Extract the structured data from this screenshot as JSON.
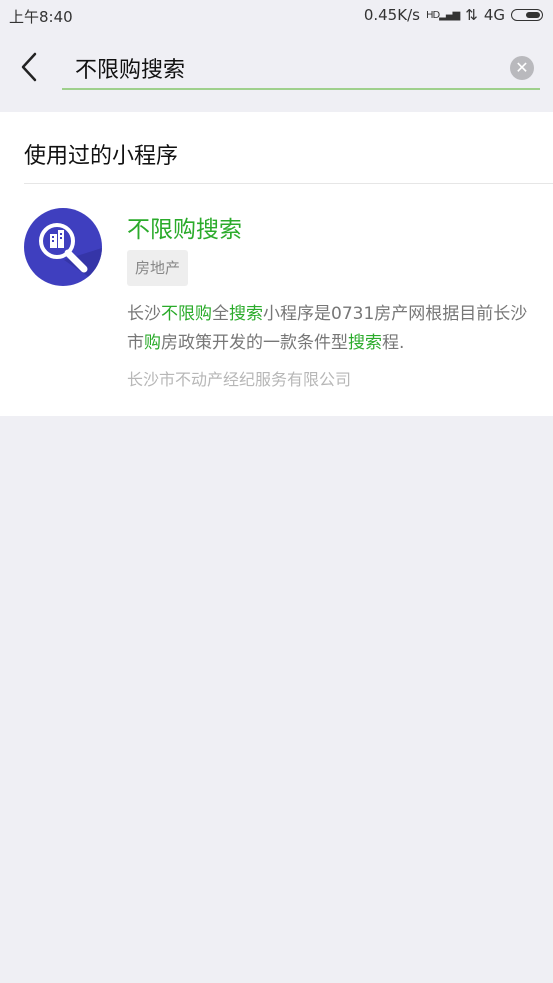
{
  "status": {
    "time": "上午8:40",
    "speed": "0.45K/s",
    "network": "4G",
    "signal_label": "HD"
  },
  "search": {
    "query": "不限购搜索"
  },
  "section": {
    "title": "使用过的小程序"
  },
  "result": {
    "name": "不限购搜索",
    "category": "房地产",
    "desc_segments": [
      "长沙",
      "不限购",
      "全",
      "搜索",
      "小程序是0731房产网根据目前长沙市",
      "购",
      "房政策开发的一款条件型",
      "搜索",
      "程."
    ],
    "company": "长沙市不动产经纪服务有限公司",
    "icon": "magnifier-building-icon"
  },
  "colors": {
    "accent_green": "#2bab2b",
    "icon_bg": "#3f3fbf"
  }
}
